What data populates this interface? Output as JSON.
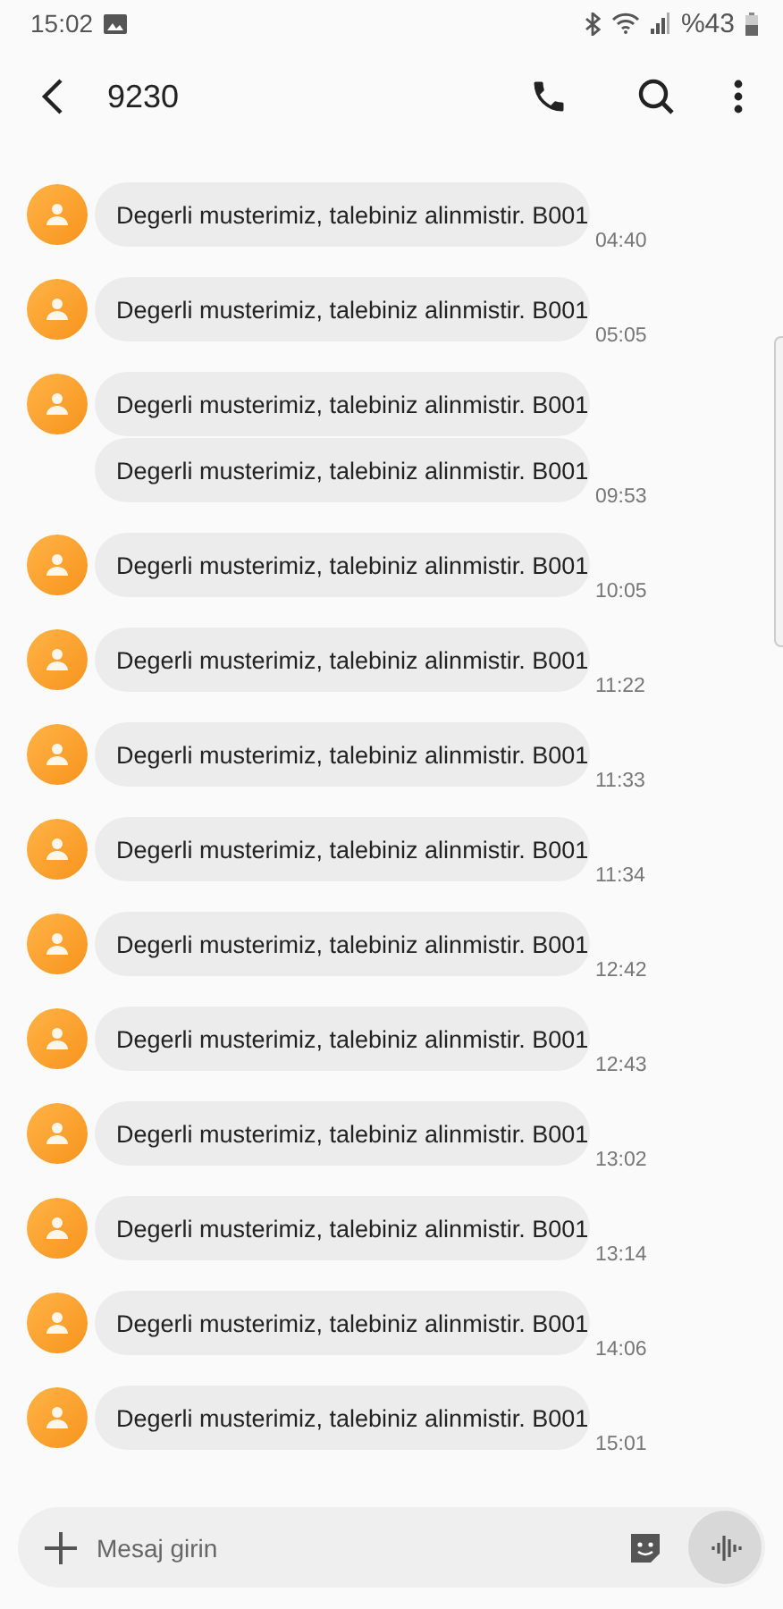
{
  "status_bar": {
    "time": "15:02",
    "battery": "%43"
  },
  "header": {
    "title": "9230"
  },
  "messages": [
    {
      "bubbles": [
        "Degerli musterimiz, talebiniz alinmistir. B001"
      ],
      "time": "04:40"
    },
    {
      "bubbles": [
        "Degerli musterimiz, talebiniz alinmistir. B001"
      ],
      "time": "05:05"
    },
    {
      "bubbles": [
        "Degerli musterimiz, talebiniz alinmistir. B001",
        "Degerli musterimiz, talebiniz alinmistir. B001"
      ],
      "time": "09:53"
    },
    {
      "bubbles": [
        "Degerli musterimiz, talebiniz alinmistir. B001"
      ],
      "time": "10:05"
    },
    {
      "bubbles": [
        "Degerli musterimiz, talebiniz alinmistir. B001"
      ],
      "time": "11:22"
    },
    {
      "bubbles": [
        "Degerli musterimiz, talebiniz alinmistir. B001"
      ],
      "time": "11:33"
    },
    {
      "bubbles": [
        "Degerli musterimiz, talebiniz alinmistir. B001"
      ],
      "time": "11:34"
    },
    {
      "bubbles": [
        "Degerli musterimiz, talebiniz alinmistir. B001"
      ],
      "time": "12:42"
    },
    {
      "bubbles": [
        "Degerli musterimiz, talebiniz alinmistir. B001"
      ],
      "time": "12:43"
    },
    {
      "bubbles": [
        "Degerli musterimiz, talebiniz alinmistir. B001"
      ],
      "time": "13:02"
    },
    {
      "bubbles": [
        "Degerli musterimiz, talebiniz alinmistir. B001"
      ],
      "time": "13:14"
    },
    {
      "bubbles": [
        "Degerli musterimiz, talebiniz alinmistir. B001"
      ],
      "time": "14:06"
    },
    {
      "bubbles": [
        "Degerli musterimiz, talebiniz alinmistir. B001"
      ],
      "time": "15:01"
    }
  ],
  "composer": {
    "placeholder": "Mesaj girin"
  }
}
